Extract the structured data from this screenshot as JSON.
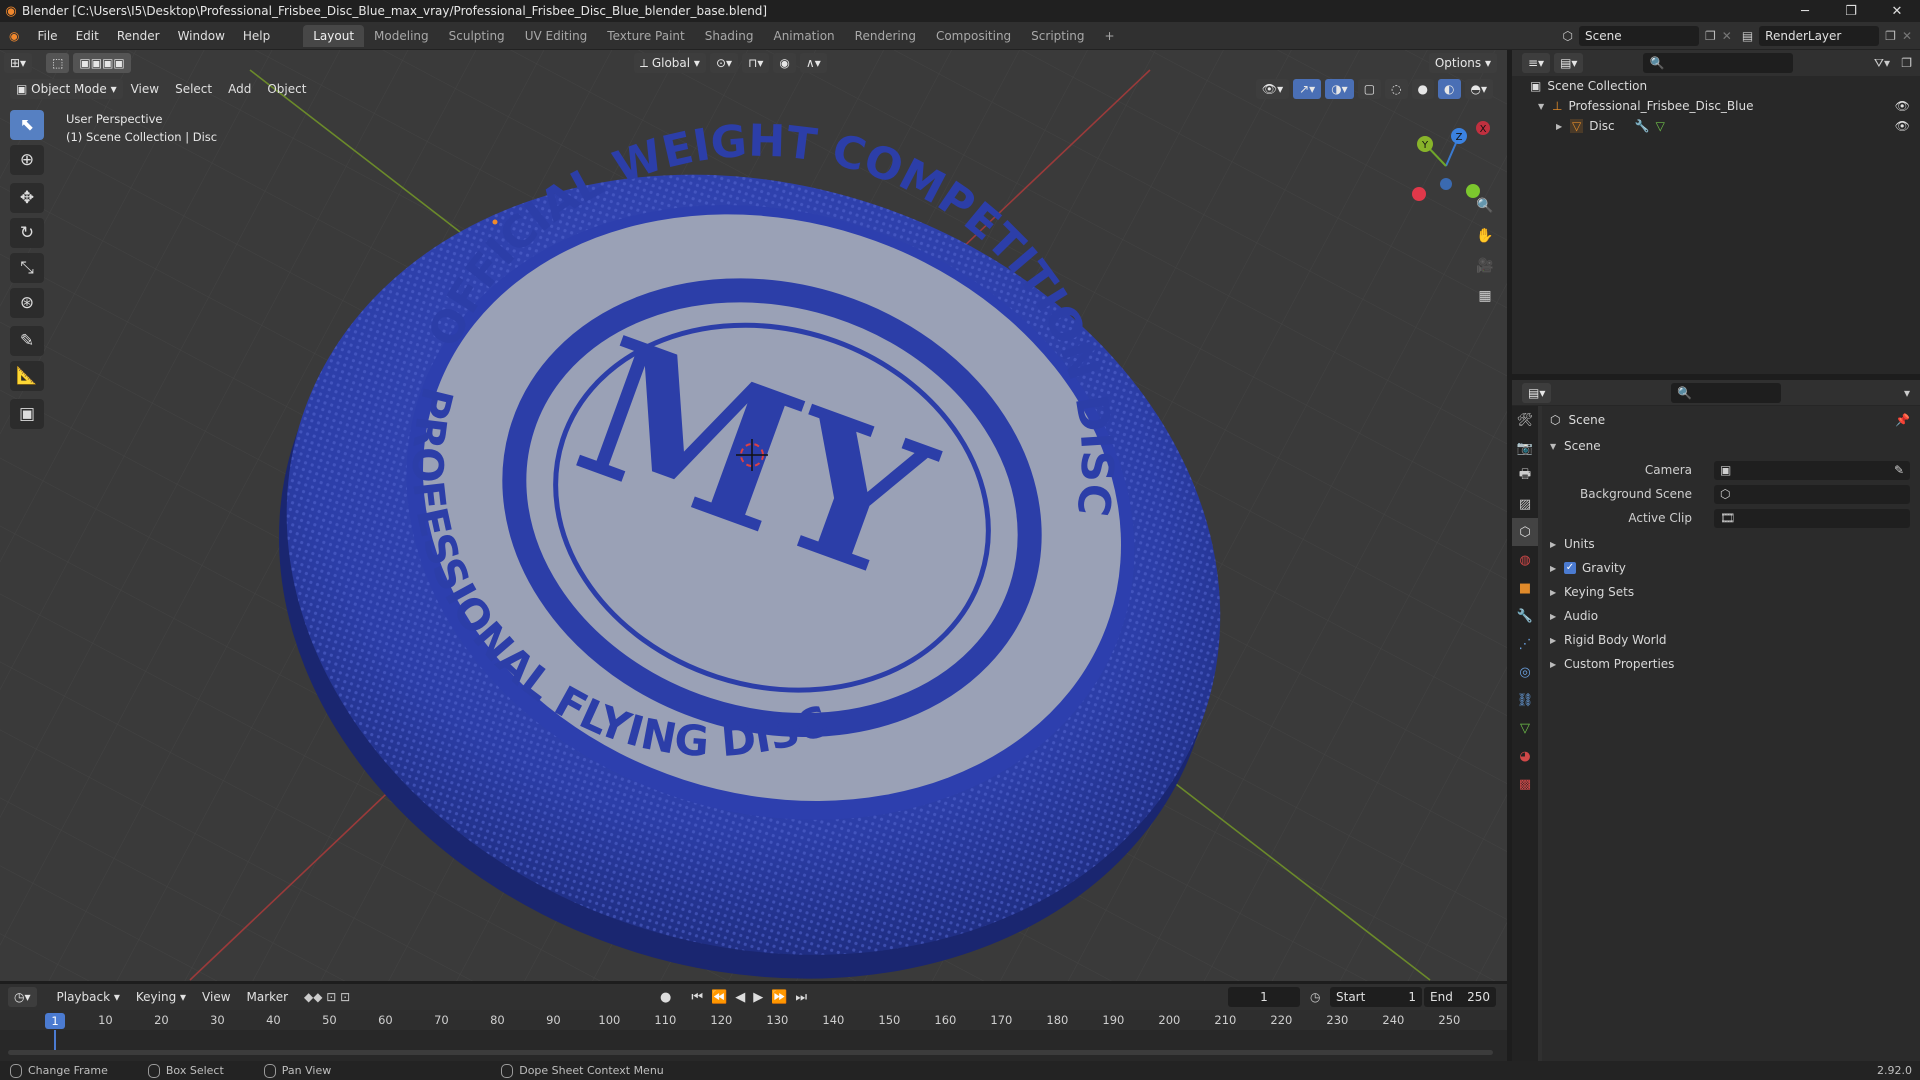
{
  "title": "Blender [C:\\Users\\I5\\Desktop\\Professional_Frisbee_Disc_Blue_max_vray/Professional_Frisbee_Disc_Blue_blender_base.blend]",
  "menu": [
    "File",
    "Edit",
    "Render",
    "Window",
    "Help"
  ],
  "workspaces": [
    "Layout",
    "Modeling",
    "Sculpting",
    "UV Editing",
    "Texture Paint",
    "Shading",
    "Animation",
    "Rendering",
    "Compositing",
    "Scripting"
  ],
  "active_workspace": "Layout",
  "scene_name": "Scene",
  "render_layer": "RenderLayer",
  "viewport": {
    "mode": "Object Mode",
    "menus": [
      "View",
      "Select",
      "Add",
      "Object"
    ],
    "orientation": "Global",
    "options": "Options",
    "overlay_line1": "User Perspective",
    "overlay_line2": "(1) Scene Collection | Disc",
    "gizmo_axes": {
      "x": "X",
      "y": "Y",
      "z": "Z"
    },
    "disc_text_top": "OFFICIAL WEIGHT COMPETITION DISC",
    "disc_text_bottom": "PROFESSIONAL FLYING DISC",
    "disc_logo": "MY",
    "colors": {
      "disc": "#2c3ea8",
      "label": "#9aa1b6",
      "grid": "#444444",
      "x_axis": "#9b3a3a",
      "y_axis": "#6b8a2a"
    }
  },
  "outliner": {
    "root": "Scene Collection",
    "items": [
      {
        "label": "Professional_Frisbee_Disc_Blue"
      },
      {
        "label": "Disc"
      }
    ]
  },
  "properties": {
    "header": "Scene",
    "section": "Scene",
    "fields": [
      {
        "label": "Camera"
      },
      {
        "label": "Background Scene"
      },
      {
        "label": "Active Clip"
      }
    ],
    "subpanels": [
      "Units",
      "Gravity",
      "Keying Sets",
      "Audio",
      "Rigid Body World",
      "Custom Properties"
    ],
    "gravity_checked": true
  },
  "timeline": {
    "menus": [
      "Playback",
      "Keying",
      "View",
      "Marker"
    ],
    "current_frame": "1",
    "start_label": "Start",
    "start": "1",
    "end_label": "End",
    "end": "250",
    "ticks": [
      "1",
      "10",
      "20",
      "30",
      "40",
      "50",
      "60",
      "70",
      "80",
      "90",
      "100",
      "110",
      "120",
      "130",
      "140",
      "150",
      "160",
      "170",
      "180",
      "190",
      "200",
      "210",
      "220",
      "230",
      "240",
      "250"
    ]
  },
  "status": {
    "items": [
      "Change Frame",
      "Box Select",
      "Pan View",
      "Dope Sheet Context Menu"
    ],
    "version": "2.92.0"
  }
}
